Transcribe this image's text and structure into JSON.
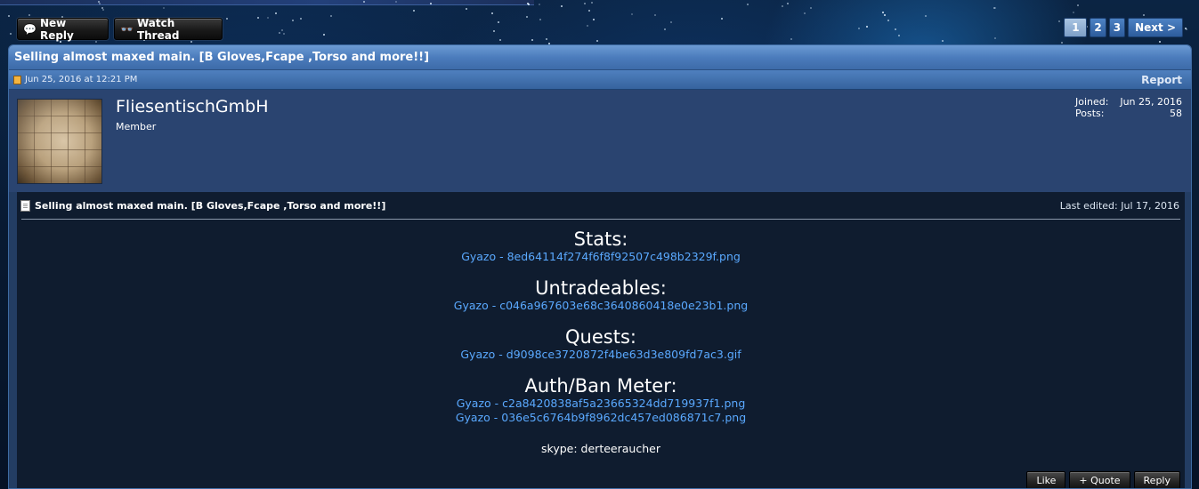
{
  "toolbar": {
    "new_reply_label": "New Reply",
    "watch_thread_label": "Watch Thread"
  },
  "pagination": {
    "pages": [
      "1",
      "2",
      "3"
    ],
    "current": "1",
    "next_label": "Next >"
  },
  "thread": {
    "title": "Selling almost maxed main. [B Gloves,Fcape ,Torso and more!!]"
  },
  "post": {
    "date": "Jun 25, 2016 at 12:21 PM",
    "report_label": "Report",
    "user": {
      "name": "FliesentischGmbH",
      "title": "Member",
      "joined_label": "Joined:",
      "joined_value": "Jun 25, 2016",
      "posts_label": "Posts:",
      "posts_value": "58"
    },
    "title": "Selling almost maxed main. [B Gloves,Fcape ,Torso and more!!]",
    "last_edited": "Last edited: Jul 17, 2016",
    "sections": [
      {
        "heading": "Stats:",
        "links": [
          "Gyazo - 8ed64114f274f6f8f92507c498b2329f.png"
        ]
      },
      {
        "heading": "Untradeables:",
        "links": [
          "Gyazo - c046a967603e68c3640860418e0e23b1.png"
        ]
      },
      {
        "heading": "Quests:",
        "links": [
          "Gyazo - d9098ce3720872f4be63d3e809fd7ac3.gif"
        ]
      },
      {
        "heading": "Auth/Ban Meter:",
        "links": [
          "Gyazo - c2a8420838af5a23665324dd719937f1.png",
          "Gyazo - 036e5c6764b9f8962dc457ed086871c7.png"
        ]
      }
    ],
    "skype": "skype: derteeraucher",
    "actions": {
      "like_label": "Like",
      "quote_label": "+ Quote",
      "reply_label": "Reply"
    }
  },
  "colors": {
    "link": "#5aa9ff",
    "title_bar": "#4b7cbc",
    "post_body": "#0f1c2f"
  }
}
